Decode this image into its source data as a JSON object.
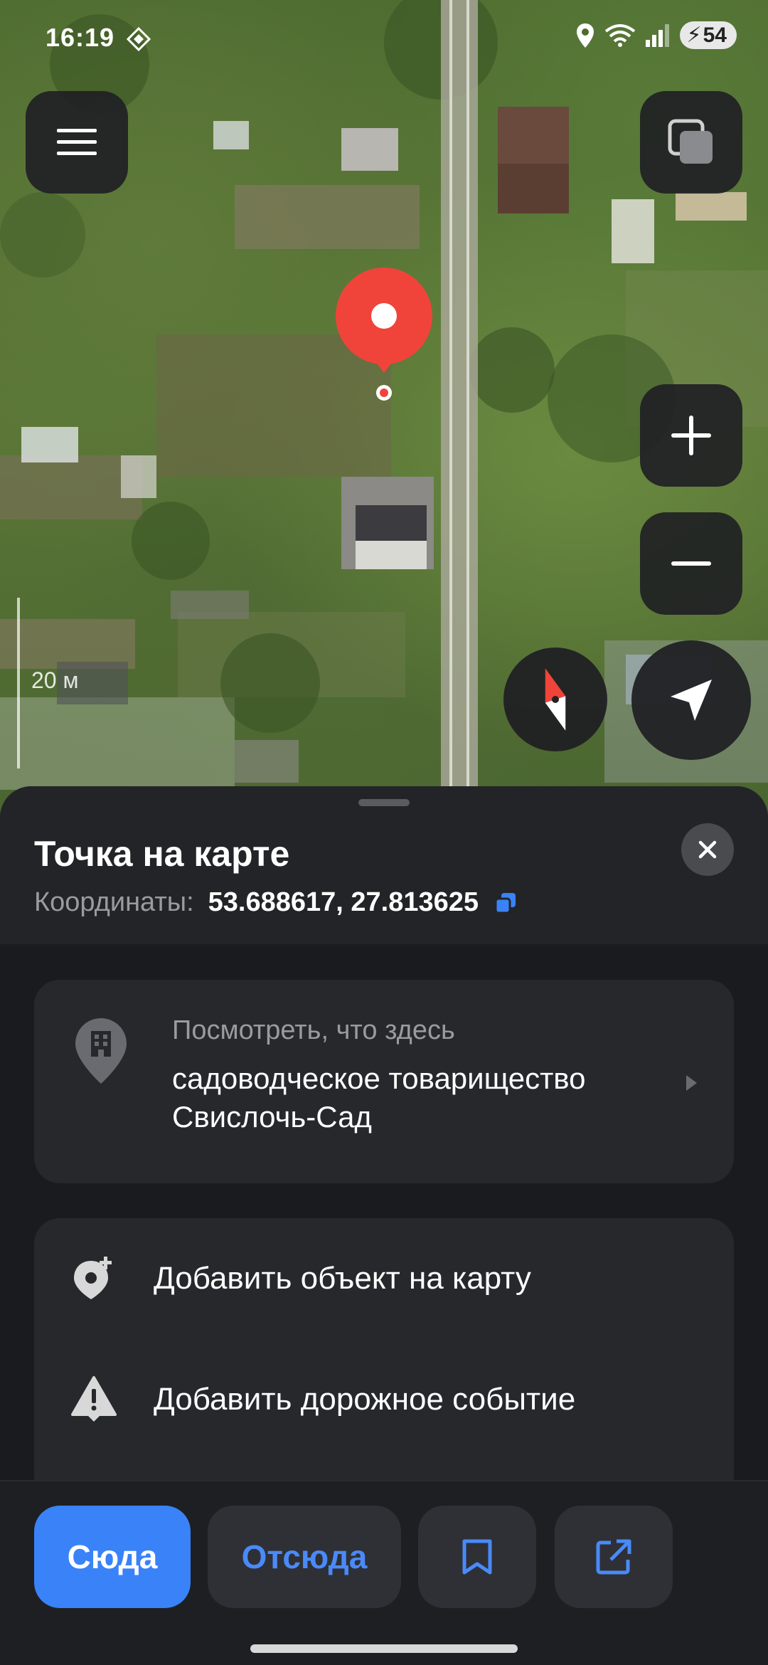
{
  "status_bar": {
    "time": "16:19",
    "battery": "54",
    "icons": [
      "location-icon",
      "wifi-icon",
      "signal-icon",
      "battery-icon"
    ]
  },
  "map": {
    "scale_label": "20 м",
    "buttons": [
      "menu-icon",
      "layers-icon",
      "zoom-in-icon",
      "zoom-out-icon",
      "compass-icon",
      "locate-icon"
    ]
  },
  "sheet": {
    "title": "Точка на карте",
    "coords_label": "Координаты:",
    "coords_value": "53.688617, 27.813625",
    "what_here": {
      "caption": "Посмотреть, что здесь",
      "name": "садоводческое товарищество Свислочь-Сад"
    },
    "actions": [
      {
        "label": "Добавить объект на карту",
        "icon": "add-place-icon"
      },
      {
        "label": "Добавить дорожное событие",
        "icon": "road-warning-icon"
      }
    ]
  },
  "bottom_bar": {
    "to_here": "Сюда",
    "from_here": "Отсюда",
    "bookmark_icon": "bookmark-icon",
    "share_icon": "share-icon"
  },
  "colors": {
    "accent_blue": "#3a82f7",
    "pin_red": "#f0443a",
    "sheet_bg": "#1a1b1e",
    "card_bg": "#27282c"
  }
}
